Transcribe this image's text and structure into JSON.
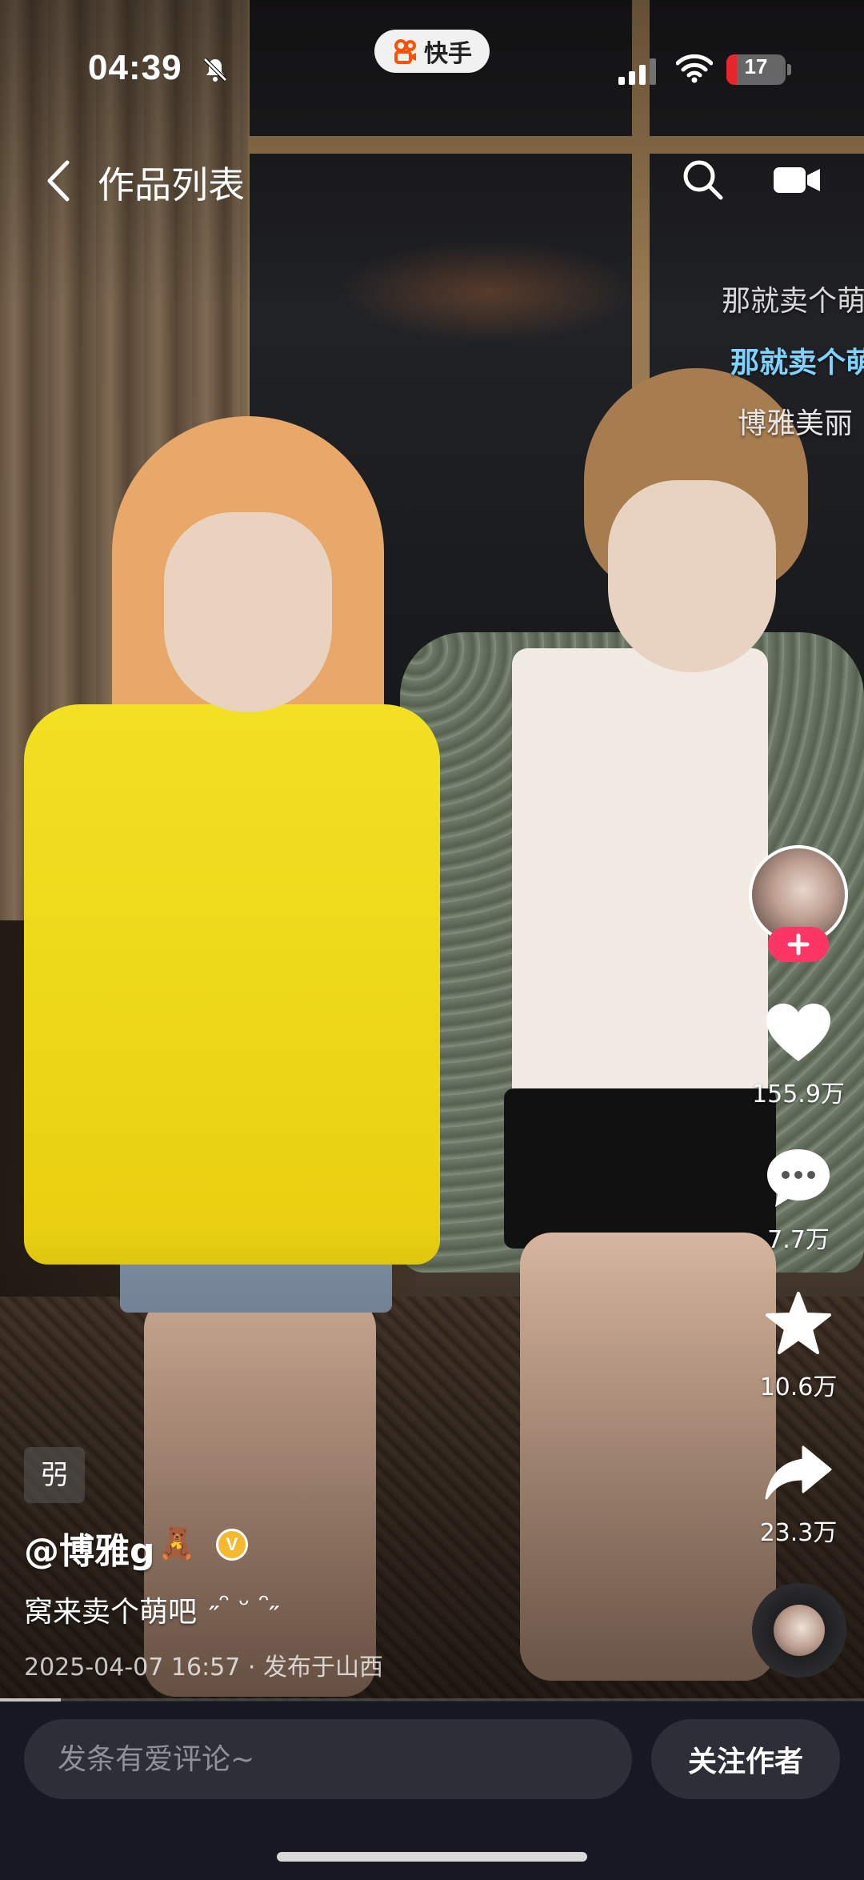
{
  "status_bar": {
    "time": "04:39",
    "app_name": "快手",
    "battery_level": "17",
    "battery_fraction": 0.17,
    "icons": [
      "bell-muted-icon",
      "kuaishou-logo-icon",
      "signal-icon",
      "wifi-icon",
      "battery-icon"
    ]
  },
  "nav": {
    "title": "作品列表",
    "icons": [
      "back-chevron-icon",
      "search-icon",
      "live-camera-icon"
    ]
  },
  "danmaku": [
    {
      "text": "那就卖个萌",
      "color": "#d8d8d8"
    },
    {
      "text": "那就卖个萌",
      "color": "#7fd3ff"
    },
    {
      "text": "博雅美丽",
      "color": "#e6e6e6"
    }
  ],
  "actions": {
    "likes": "155.9万",
    "comments": "7.7万",
    "favorites": "10.6万",
    "shares": "23.3万",
    "icons": [
      "heart-icon",
      "comment-bubble-icon",
      "star-icon",
      "share-arrow-icon",
      "plus-icon",
      "music-disc-icon"
    ]
  },
  "post": {
    "tag": "弜",
    "author": "@博雅g",
    "author_emoji": "🧸",
    "verified_mark": "V",
    "caption": "窝来卖个萌吧",
    "caption_emoji": "˶ᵔ ᵕ ᵔ˶",
    "date": "2025-04-07 16:57",
    "separator": "·",
    "location": "发布于山西",
    "progress": 0.07
  },
  "bottom": {
    "comment_placeholder": "发条有爱评论~",
    "follow_label": "关注作者"
  },
  "colors": {
    "accent_pink": "#fe3666",
    "battery_red": "#e8262d",
    "bottom_bar": "#161823",
    "verified_gold": "#f5b82e"
  }
}
